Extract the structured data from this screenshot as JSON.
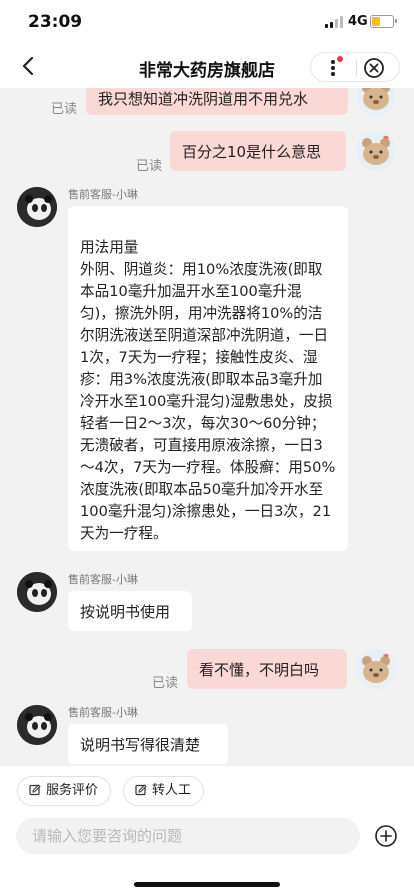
{
  "status": {
    "time": "23:09",
    "network": "4G"
  },
  "nav": {
    "title": "非常大药房旗舰店"
  },
  "messages": {
    "m1": {
      "text": "我只想知道冲洗阴道用不用兑水",
      "read": "已读"
    },
    "m2": {
      "text": "百分之10是什么意思",
      "read": "已读"
    },
    "m3": {
      "agent": "售前客服-小琳",
      "text": "用法用量\n外阴、阴道炎：用10%浓度洗液(即取本品10毫升加温开水至100毫升混匀)，擦洗外阴，用冲洗器将10%的洁尔阴洗液送至阴道深部冲洗阴道，一日1次，7天为一疗程；接触性皮炎、湿疹：用3%浓度洗液(即取本品3毫升加冷开水至100毫升混匀)湿敷患处，皮损轻者一日2～3次，每次30～60分钟；无溃破者，可直接用原液涂擦，一日3～4次，7天为一疗程。体股癣：用50%浓度洗液(即取本品50毫升加冷开水至100毫升混匀)涂擦患处，一日3次，21天为一疗程。"
    },
    "m4": {
      "agent": "售前客服-小琳",
      "text": "按说明书使用"
    },
    "m5": {
      "text": "看不懂，不明白吗",
      "read": "已读"
    },
    "m6": {
      "agent": "售前客服-小琳",
      "text": "说明书写得很清楚"
    }
  },
  "quick_actions": {
    "rate": "服务评价",
    "human": "转人工"
  },
  "input": {
    "placeholder": "请输入您要咨询的问题"
  },
  "icons": {
    "back": "chevron-left-icon",
    "more": "more-dots-icon",
    "close": "close-circle-icon",
    "plus": "plus-circle-icon",
    "edit": "edit-icon"
  },
  "colors": {
    "out_bubble": "#f9d8d5",
    "in_bubble": "#ffffff",
    "battery": "#f4c21f",
    "badge": "#e63c3c"
  }
}
